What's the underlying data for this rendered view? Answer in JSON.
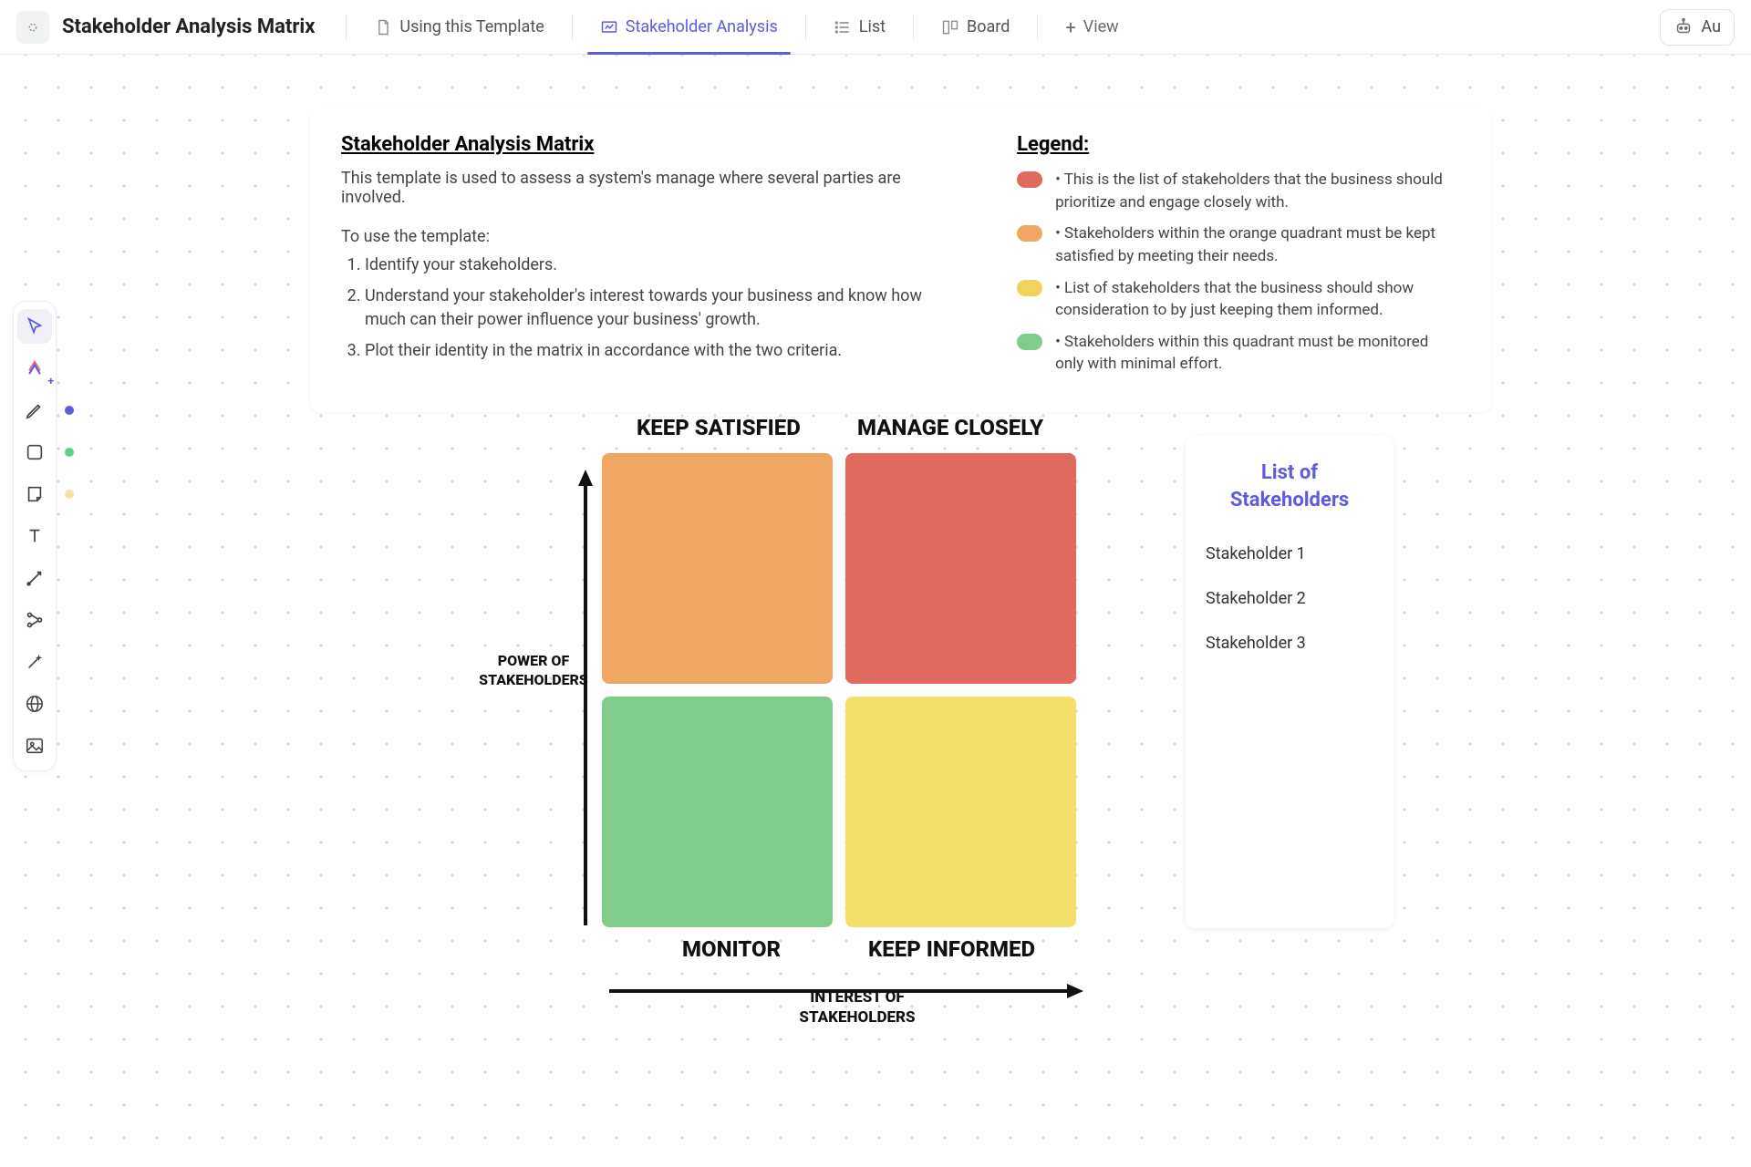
{
  "header": {
    "title": "Stakeholder Analysis Matrix",
    "views": [
      {
        "label": "Using this Template",
        "icon": "doc-icon",
        "active": false
      },
      {
        "label": "Stakeholder Analysis",
        "icon": "whiteboard-icon",
        "active": true
      },
      {
        "label": "List",
        "icon": "list-icon",
        "active": false
      },
      {
        "label": "Board",
        "icon": "board-icon",
        "active": false
      }
    ],
    "add_view_label": "View",
    "ai_button": "Au"
  },
  "info": {
    "title": "Stakeholder Analysis Matrix",
    "description": "This template is used to assess a system's manage where several parties are involved.",
    "howto_label": "To use the template:",
    "steps": [
      "Identify your stakeholders.",
      "Understand your stakeholder's interest towards your business and know how much can their power influence your business' growth.",
      "Plot their identity in the matrix in accordance with the two criteria."
    ],
    "legend_title": "Legend:",
    "legend": [
      {
        "color": "#e06a5e",
        "text": "This is the list of stakeholders that the business should prioritize and engage closely with."
      },
      {
        "color": "#efa663",
        "text": "Stakeholders within the orange quadrant must be kept satisfied by meeting their needs."
      },
      {
        "color": "#f3d25b",
        "text": "List of stakeholders that the business should show consideration to by just keeping them informed."
      },
      {
        "color": "#80cd8b",
        "text": "Stakeholders within this quadrant must be monitored only with minimal effort."
      }
    ]
  },
  "matrix": {
    "top_left_label": "KEEP SATISFIED",
    "top_right_label": "MANAGE CLOSELY",
    "bottom_left_label": "MONITOR",
    "bottom_right_label": "KEEP INFORMED",
    "y_axis": "POWER OF STAKEHOLDERS",
    "x_axis": "INTEREST OF STAKEHOLDERS",
    "colors": {
      "top_left": "#efa663",
      "top_right": "#e06a5e",
      "bottom_left": "#80cd8b",
      "bottom_right": "#f3e06b"
    }
  },
  "stakeholders": {
    "title": "List of Stakeholders",
    "items": [
      "Stakeholder 1",
      "Stakeholder 2",
      "Stakeholder 3"
    ]
  },
  "toolbar_dots": {
    "pen": "#5d5cde",
    "shape": "#5ed08f",
    "sticky": "#f7e59b"
  }
}
